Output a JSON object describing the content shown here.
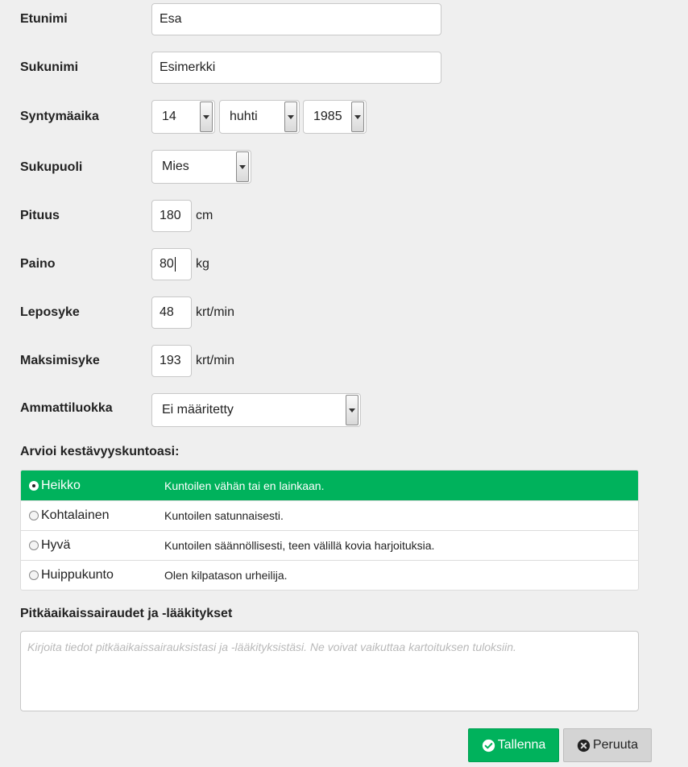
{
  "fields": {
    "first_name": {
      "label": "Etunimi",
      "value": "Esa"
    },
    "last_name": {
      "label": "Sukunimi",
      "value": "Esimerkki"
    },
    "birthdate": {
      "label": "Syntymäaika",
      "day": "14",
      "month": "huhti",
      "year": "1985"
    },
    "gender": {
      "label": "Sukupuoli",
      "value": "Mies"
    },
    "height": {
      "label": "Pituus",
      "value": "180",
      "unit": "cm"
    },
    "weight": {
      "label": "Paino",
      "value": "80",
      "unit": "kg"
    },
    "resting_hr": {
      "label": "Leposyke",
      "value": "48",
      "unit": "krt/min"
    },
    "max_hr": {
      "label": "Maksimisyke",
      "value": "193",
      "unit": "krt/min"
    },
    "occupation": {
      "label": "Ammattiluokka",
      "value": "Ei määritetty"
    }
  },
  "fitness": {
    "heading": "Arvioi kestävyyskuntoasi:",
    "options": [
      {
        "name": "Heikko",
        "description": "Kuntoilen vähän tai en lainkaan.",
        "selected": true
      },
      {
        "name": "Kohtalainen",
        "description": "Kuntoilen satunnaisesti.",
        "selected": false
      },
      {
        "name": "Hyvä",
        "description": "Kuntoilen säännöllisesti, teen välillä kovia harjoituksia.",
        "selected": false
      },
      {
        "name": "Huippukunto",
        "description": "Olen kilpatason urheilija.",
        "selected": false
      }
    ]
  },
  "chronic": {
    "heading": "Pitkäaikaissairaudet ja -lääkitykset",
    "placeholder": "Kirjoita tiedot pitkäaikaissairauksistasi ja -lääkityksistäsi. Ne voivat vaikuttaa kartoituksen tuloksiin."
  },
  "actions": {
    "save_label": "Tallenna",
    "cancel_label": "Peruuta"
  },
  "colors": {
    "accent": "#00b25c",
    "background": "#efefef"
  },
  "icons": {
    "save": "check-circle-icon",
    "cancel": "x-circle-icon",
    "dropdown": "chevron-down-icon"
  }
}
